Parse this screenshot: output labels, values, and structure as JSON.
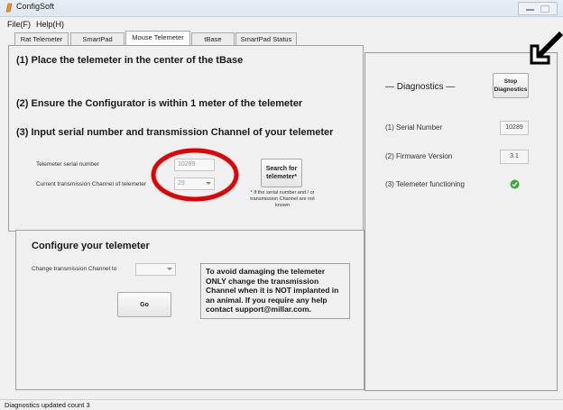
{
  "window": {
    "title": "ConfigSoft"
  },
  "menu": {
    "file": "File(F)",
    "help": "Help(H)"
  },
  "tabs": [
    {
      "label": "Rat Telemeter"
    },
    {
      "label": "SmartPad"
    },
    {
      "label": "Mouse Telemeter",
      "active": true
    },
    {
      "label": "tBase"
    },
    {
      "label": "SmartPad Status"
    }
  ],
  "instructions": {
    "step1": "(1) Place the telemeter in the center of the tBase",
    "step2": "(2) Ensure the Configurator is within 1 meter of the telemeter",
    "step3": "(3) Input serial number and transmission Channel of your telemeter"
  },
  "telemeter": {
    "serial_label": "Telemeter serial number",
    "serial_value": "10289",
    "channel_label": "Current transmission Channel of telemeter",
    "channel_value": "29",
    "search_button": "Search for telemeter*",
    "search_note": "* If the serial number and / or transmission Channel are not known"
  },
  "configure": {
    "heading": "Configure your telemeter",
    "change_label": "Change transmission Channel to",
    "change_value": "",
    "go_button": "Go",
    "warning": "To avoid damaging the telemeter ONLY change the transmission Channel when it is NOT implanted in an animal.  If you require any help contact support@millar.com."
  },
  "diagnostics": {
    "title": "— Diagnostics —",
    "stop_button": "Stop Diagnostics",
    "serial_label": "(1) Serial Number",
    "serial_value": "10289",
    "firmware_label": "(2) Firmware Version",
    "firmware_value": "3.1",
    "functioning_label": "(3) Telemeter functioning",
    "functioning_icon": "green-check-icon"
  },
  "status": {
    "text": "Diagnostics updated count 3"
  },
  "colors": {
    "annotation_red": "#e00000",
    "check_green": "#3aa83a",
    "titlebar": "#e2e9f2"
  }
}
